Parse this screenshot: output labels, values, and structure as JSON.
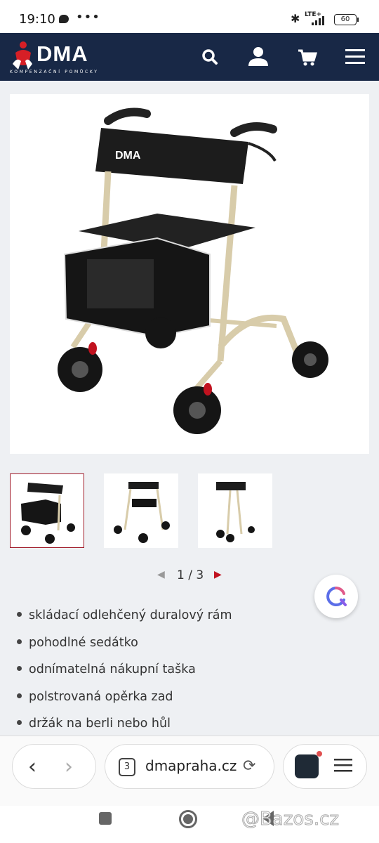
{
  "status_bar": {
    "time": "19:10",
    "network": "LTE+",
    "battery": "60"
  },
  "header": {
    "logo_text": "DMA",
    "logo_subtitle": "KOMPENZAČNÍ POMŮCKY",
    "background_color": "#182846",
    "icons": [
      "search-icon",
      "user-icon",
      "cart-icon",
      "menu-icon"
    ]
  },
  "product": {
    "main_image_logo": "DMA",
    "pager": {
      "current": 1,
      "total": 3,
      "text": "1 / 3"
    },
    "accent_color": "#c1121f",
    "features": [
      "skládací odlehčený duralový rám",
      "pohodlné sedátko",
      "odnímatelná nákupní taška",
      "polstrovaná opěrka zad",
      "držák na berli nebo hůl"
    ]
  },
  "browser": {
    "tab_count": "3",
    "url": "dmapraha.cz"
  },
  "watermark": "@Bazos.cz"
}
